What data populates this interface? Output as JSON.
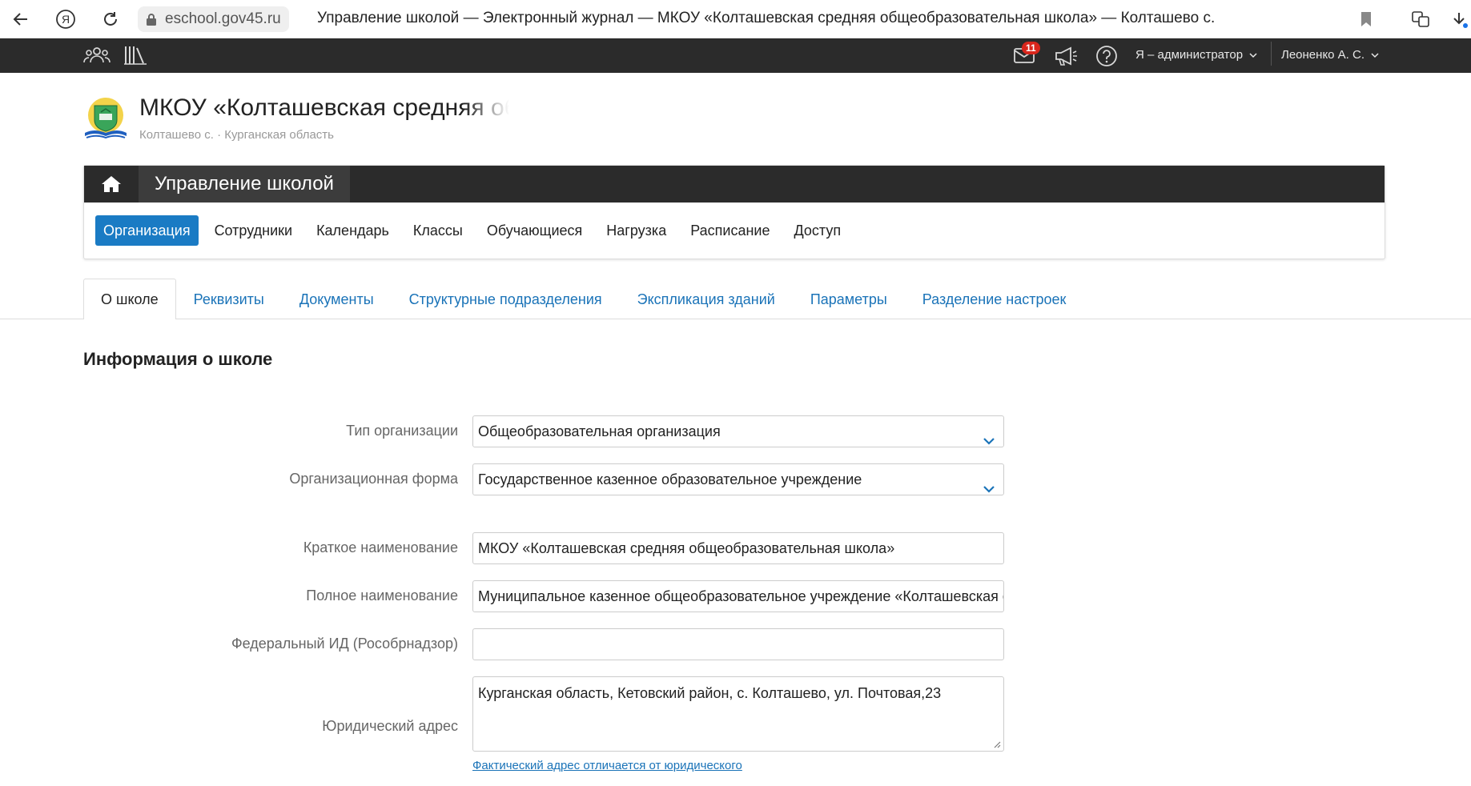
{
  "browser": {
    "url": "eschool.gov45.ru",
    "page_title": "Управление школой — Электронный журнал — МКОУ «Колташевская средняя общеобразовательная школа» — Колташево с."
  },
  "topbar": {
    "mail_count": "11",
    "role_label": "Я – администратор",
    "user_label": "Леоненко А. С."
  },
  "header": {
    "school_name": "МКОУ «Колташевская средняя общеобразовательная школа»",
    "location": "Колташево с. · Курганская область"
  },
  "section": {
    "title": "Управление школой",
    "nav": [
      {
        "label": "Организация",
        "active": true
      },
      {
        "label": "Сотрудники"
      },
      {
        "label": "Календарь"
      },
      {
        "label": "Классы"
      },
      {
        "label": "Обучающиеся"
      },
      {
        "label": "Нагрузка"
      },
      {
        "label": "Расписание"
      },
      {
        "label": "Доступ"
      }
    ]
  },
  "tabs": [
    {
      "label": "О школе",
      "active": true
    },
    {
      "label": "Реквизиты"
    },
    {
      "label": "Документы"
    },
    {
      "label": "Структурные подразделения"
    },
    {
      "label": "Экспликация зданий"
    },
    {
      "label": "Параметры"
    },
    {
      "label": "Разделение настроек"
    }
  ],
  "form": {
    "heading": "Информация о школе",
    "org_type": {
      "label": "Тип организации",
      "value": "Общеобразовательная организация"
    },
    "org_form": {
      "label": "Организационная форма",
      "value": "Государственное казенное образовательное учреждение"
    },
    "short_name": {
      "label": "Краткое наименование",
      "value": "МКОУ «Колташевская средняя общеобразовательная школа»"
    },
    "full_name": {
      "label": "Полное наименование",
      "value": "Муниципальное казенное общеобразовательное учреждение «Колташевская средняя общеобразовательная школа»"
    },
    "federal_id": {
      "label": "Федеральный ИД (Рособрнадзор)",
      "value": ""
    },
    "legal_address": {
      "label": "Юридический адрес",
      "value": "Курганская область, Кетовский район, с. Колташево, ул. Почтовая,23"
    },
    "actual_address_link": "Фактический адрес отличается от юридического"
  },
  "colors": {
    "accent": "#1a7bc4",
    "topbar": "#2b2b2b",
    "link": "#1a73b8",
    "badge": "#d9261c"
  }
}
